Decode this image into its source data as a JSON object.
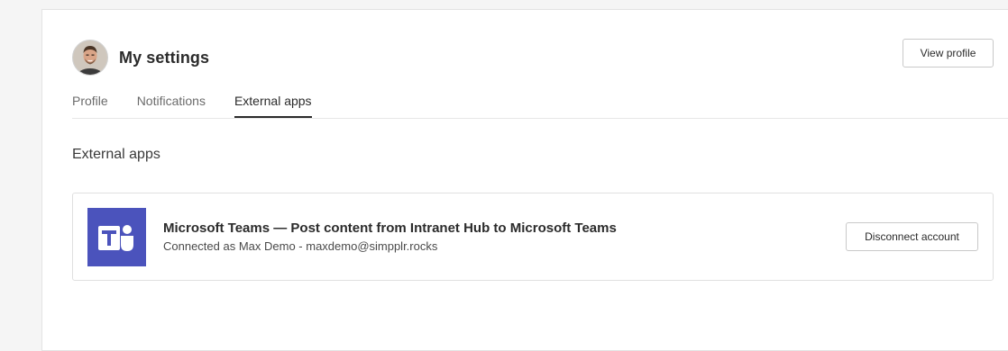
{
  "header": {
    "title": "My settings",
    "view_profile_label": "View profile"
  },
  "tabs": [
    {
      "label": "Profile",
      "active": false
    },
    {
      "label": "Notifications",
      "active": false
    },
    {
      "label": "External apps",
      "active": true
    }
  ],
  "section": {
    "title": "External apps"
  },
  "apps": [
    {
      "name": "Microsoft Teams — Post content from Intranet Hub to Microsoft Teams",
      "status": "Connected as Max Demo - maxdemo@simpplr.rocks",
      "action_label": "Disconnect account",
      "icon": "microsoft-teams-logo",
      "brand_color": "#4b53bc"
    }
  ],
  "colors": {
    "background": "#f5f5f5",
    "panel": "#ffffff",
    "active_tab_underline": "#2b2b2b"
  }
}
